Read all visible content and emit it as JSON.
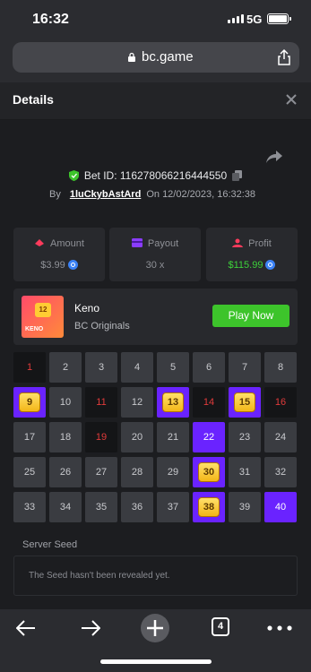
{
  "status": {
    "time": "16:32",
    "network": "5G"
  },
  "browser": {
    "url": "bc.game",
    "tab_count": "4"
  },
  "header": {
    "title": "Details"
  },
  "bet": {
    "id_label": "Bet ID: 116278066216444550",
    "by_label": "By",
    "username": "1luCkybAstArd",
    "on_label": "On",
    "datetime": "12/02/2023, 16:32:38"
  },
  "stats": {
    "amount_label": "Amount",
    "amount_value": "$3.99",
    "payout_label": "Payout",
    "payout_value": "30 x",
    "profit_label": "Profit",
    "profit_value": "$115.99"
  },
  "game": {
    "name": "Keno",
    "provider": "BC Originals",
    "play_label": "Play Now",
    "thumb_number": "12",
    "thumb_text": "KENO"
  },
  "grid": {
    "tiles": [
      {
        "n": "1",
        "s": "miss"
      },
      {
        "n": "2",
        "s": "normal"
      },
      {
        "n": "3",
        "s": "normal"
      },
      {
        "n": "4",
        "s": "normal"
      },
      {
        "n": "5",
        "s": "normal"
      },
      {
        "n": "6",
        "s": "normal"
      },
      {
        "n": "7",
        "s": "normal"
      },
      {
        "n": "8",
        "s": "normal"
      },
      {
        "n": "9",
        "s": "hit"
      },
      {
        "n": "10",
        "s": "normal"
      },
      {
        "n": "11",
        "s": "miss"
      },
      {
        "n": "12",
        "s": "normal"
      },
      {
        "n": "13",
        "s": "hit"
      },
      {
        "n": "14",
        "s": "miss"
      },
      {
        "n": "15",
        "s": "hit"
      },
      {
        "n": "16",
        "s": "miss"
      },
      {
        "n": "17",
        "s": "normal"
      },
      {
        "n": "18",
        "s": "normal"
      },
      {
        "n": "19",
        "s": "miss"
      },
      {
        "n": "20",
        "s": "normal"
      },
      {
        "n": "21",
        "s": "normal"
      },
      {
        "n": "22",
        "s": "picked"
      },
      {
        "n": "23",
        "s": "normal"
      },
      {
        "n": "24",
        "s": "normal"
      },
      {
        "n": "25",
        "s": "normal"
      },
      {
        "n": "26",
        "s": "normal"
      },
      {
        "n": "27",
        "s": "normal"
      },
      {
        "n": "28",
        "s": "normal"
      },
      {
        "n": "29",
        "s": "normal"
      },
      {
        "n": "30",
        "s": "hit"
      },
      {
        "n": "31",
        "s": "normal"
      },
      {
        "n": "32",
        "s": "normal"
      },
      {
        "n": "33",
        "s": "normal"
      },
      {
        "n": "34",
        "s": "normal"
      },
      {
        "n": "35",
        "s": "normal"
      },
      {
        "n": "36",
        "s": "normal"
      },
      {
        "n": "37",
        "s": "normal"
      },
      {
        "n": "38",
        "s": "hit"
      },
      {
        "n": "39",
        "s": "normal"
      },
      {
        "n": "40",
        "s": "picked"
      }
    ]
  },
  "seed": {
    "label": "Server Seed",
    "text": "The Seed hasn't been revealed yet."
  },
  "colors": {
    "accent": "#6a23ff",
    "play": "#3dc42b",
    "miss": "#e13b3b",
    "gem": "#f3b618",
    "profit": "#3dd13a"
  }
}
